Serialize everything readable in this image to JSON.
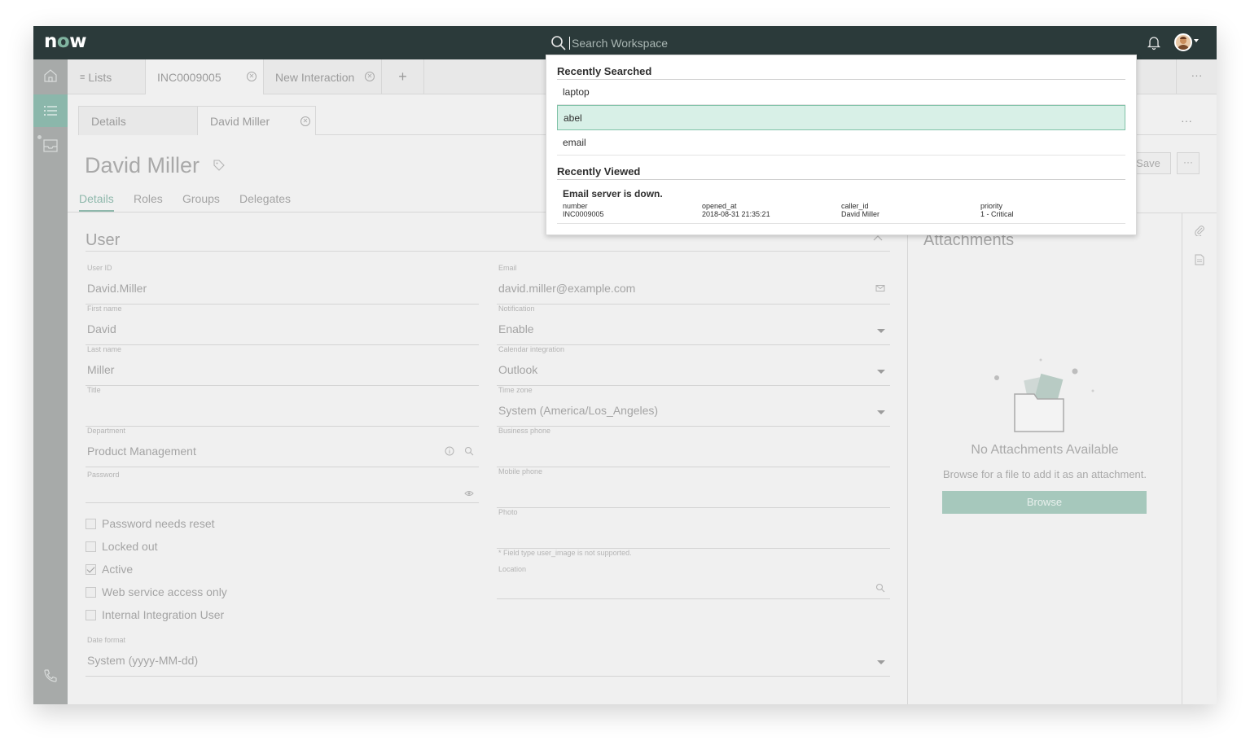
{
  "app": {
    "logo_prefix": "n",
    "logo_o": "o",
    "logo_suffix": "w"
  },
  "search": {
    "placeholder": "Search Workspace"
  },
  "tabs": [
    {
      "label": "Lists"
    },
    {
      "label": "INC0009005"
    },
    {
      "label": "New Interaction"
    }
  ],
  "subtabs": [
    {
      "label": "Details"
    },
    {
      "label": "David Miller"
    }
  ],
  "record": {
    "title": "David Miller",
    "save_label": "Save",
    "more_label": "···"
  },
  "form_tabs": [
    "Details",
    "Roles",
    "Groups",
    "Delegates"
  ],
  "section": {
    "title": "User"
  },
  "fields": {
    "user_id": {
      "label": "User ID",
      "value": "David.Miller"
    },
    "first_name": {
      "label": "First name",
      "value": "David"
    },
    "last_name": {
      "label": "Last name",
      "value": "Miller"
    },
    "title": {
      "label": "Title",
      "value": ""
    },
    "department": {
      "label": "Department",
      "value": "Product Management"
    },
    "password": {
      "label": "Password",
      "value": ""
    },
    "email": {
      "label": "Email",
      "value": "david.miller@example.com"
    },
    "notification": {
      "label": "Notification",
      "value": "Enable"
    },
    "calendar": {
      "label": "Calendar integration",
      "value": "Outlook"
    },
    "timezone": {
      "label": "Time zone",
      "value": "System (America/Los_Angeles)"
    },
    "business_phone": {
      "label": "Business phone",
      "value": ""
    },
    "mobile_phone": {
      "label": "Mobile phone",
      "value": ""
    },
    "photo": {
      "label": "Photo",
      "value": ""
    },
    "photo_note": "* Field type user_image is not supported.",
    "location": {
      "label": "Location",
      "value": ""
    },
    "date_format": {
      "label": "Date format",
      "value": "System (yyyy-MM-dd)"
    }
  },
  "checkboxes": [
    {
      "label": "Password needs reset",
      "checked": false
    },
    {
      "label": "Locked out",
      "checked": false
    },
    {
      "label": "Active",
      "checked": true
    },
    {
      "label": "Web service access only",
      "checked": false
    },
    {
      "label": "Internal Integration User",
      "checked": false
    }
  ],
  "attachments": {
    "title": "Attachments",
    "empty_title": "No Attachments Available",
    "hint": "Browse for a file to add it as an attachment.",
    "browse_label": "Browse"
  },
  "dropdown": {
    "recent_searched_title": "Recently Searched",
    "recent_searched": [
      "laptop",
      "abel",
      "email"
    ],
    "recent_viewed_title": "Recently Viewed",
    "recent_viewed": {
      "title": "Email server is down.",
      "columns": [
        {
          "name": "number",
          "value": "INC0009005"
        },
        {
          "name": "opened_at",
          "value": "2018-08-31 21:35:21"
        },
        {
          "name": "caller_id",
          "value": "David Miller"
        },
        {
          "name": "priority",
          "value": "1 - Critical"
        }
      ]
    }
  },
  "colors": {
    "topbar": "#2b3a3a",
    "accent": "#8fb8ac",
    "highlight": "#d8f0e7"
  }
}
